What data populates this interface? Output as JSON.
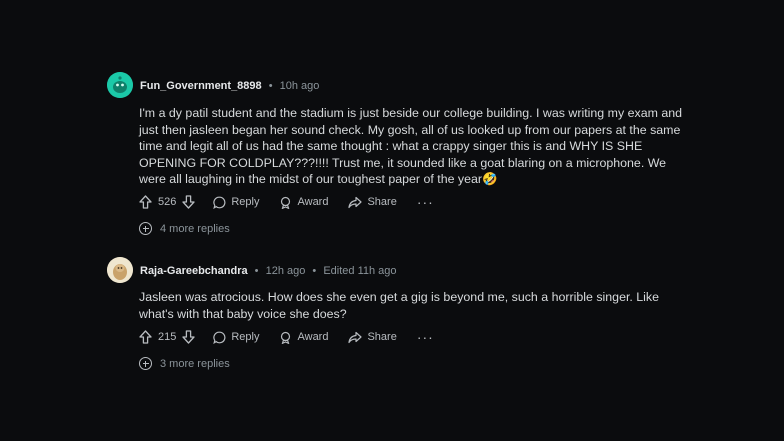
{
  "comments": [
    {
      "username": "Fun_Government_8898",
      "time": "10h ago",
      "edited": "",
      "text": "I'm a dy patil student and the stadium is just beside our college building. I was writing my exam and just then jasleen began her sound check. My gosh, all of us looked up from our papers at the same time and legit all of us had the same thought : what a crappy singer this is and WHY IS SHE OPENING FOR COLDPLAY???!!!! Trust me, it sounded like a goat blaring on a microphone. We were all laughing in the midst of our toughest paper of the year🤣",
      "votes": "526",
      "reply_label": "Reply",
      "award_label": "Award",
      "share_label": "Share",
      "more_label": "···",
      "more_replies": "4 more replies",
      "avatar_color": "#19c3a3"
    },
    {
      "username": "Raja-Gareebchandra",
      "time": "12h ago",
      "edited": "Edited 11h ago",
      "text": "Jasleen was atrocious. How does she even get a gig is beyond me, such a horrible singer. Like what's with that baby voice she does?",
      "votes": "215",
      "reply_label": "Reply",
      "award_label": "Award",
      "share_label": "Share",
      "more_label": "···",
      "more_replies": "3 more replies",
      "avatar_color": "#c9b48a"
    }
  ]
}
